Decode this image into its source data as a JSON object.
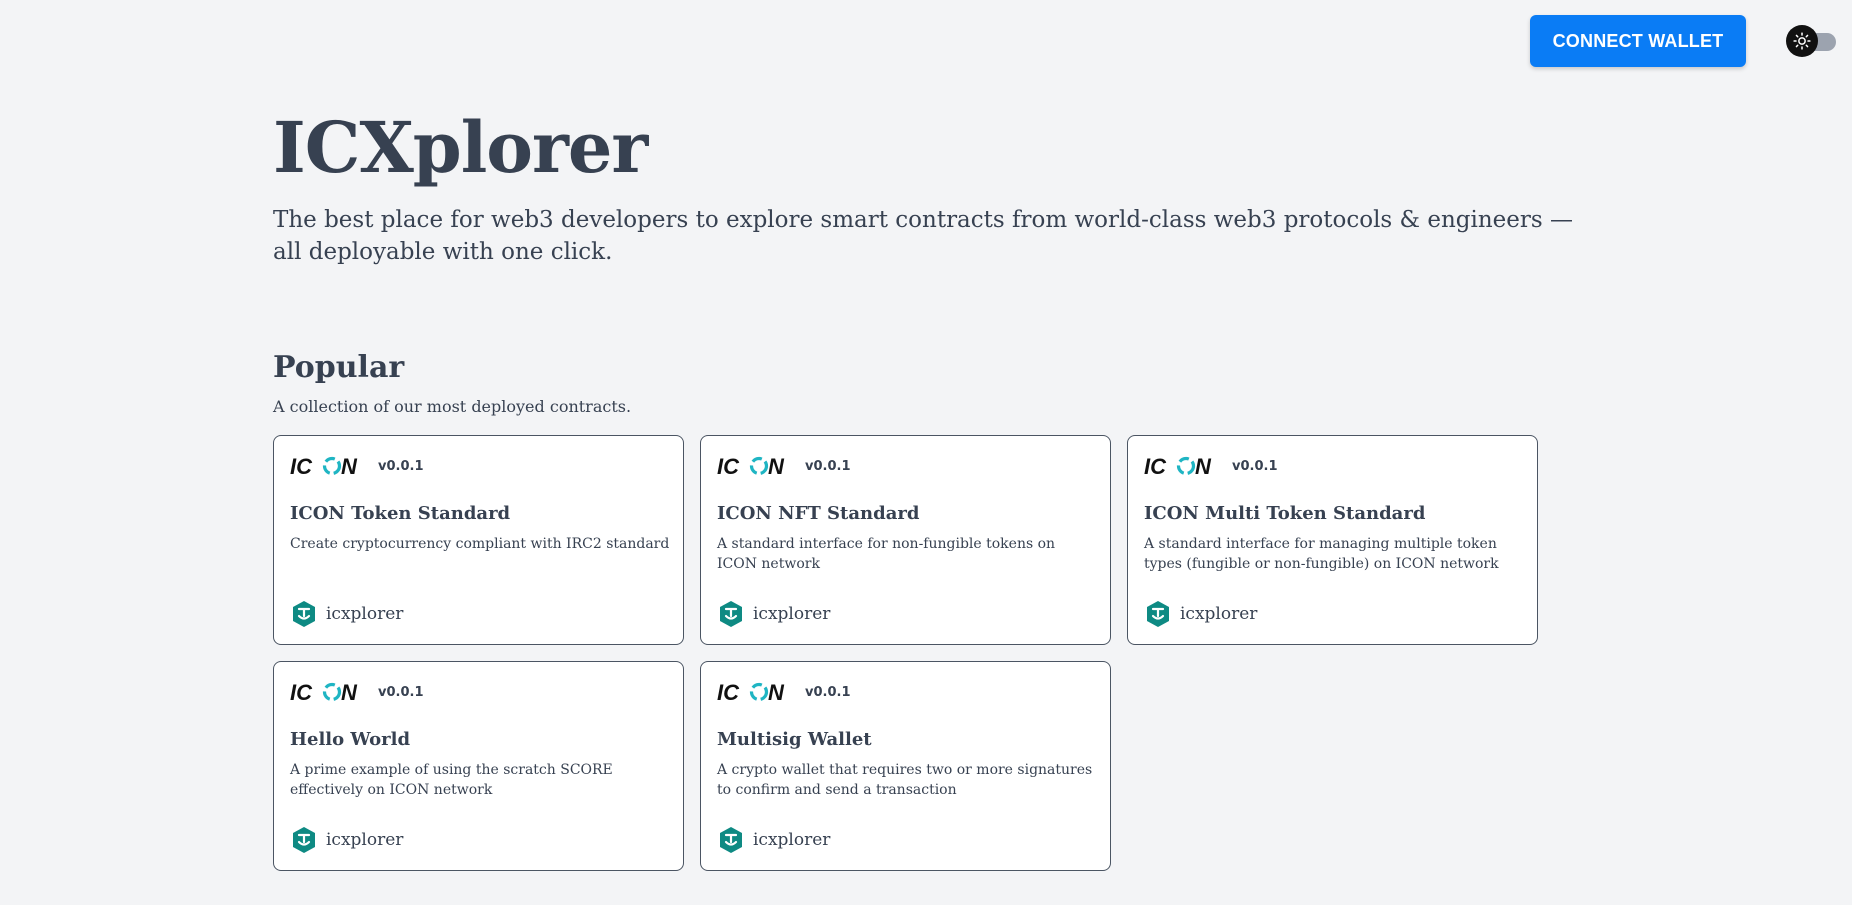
{
  "header": {
    "connect_label": "CONNECT WALLET",
    "theme_toggle_icon": "sun-icon"
  },
  "hero": {
    "title": "ICXplorer",
    "tagline": "The best place for web3 developers to explore smart contracts from world-class web3 protocols & engineers — all deployable with one click."
  },
  "popular": {
    "title": "Popular",
    "subtitle": "A collection of our most deployed contracts.",
    "cards": [
      {
        "logo_icon": "icon-network-logo",
        "version": "v0.0.1",
        "title": "ICON Token Standard",
        "description": "Create cryptocurrency compliant with IRC2 standard",
        "author": "icxplorer",
        "author_icon": "icxplorer-avatar-icon"
      },
      {
        "logo_icon": "icon-network-logo",
        "version": "v0.0.1",
        "title": "ICON NFT Standard",
        "description": "A standard interface for non-fungible tokens on ICON network",
        "author": "icxplorer",
        "author_icon": "icxplorer-avatar-icon"
      },
      {
        "logo_icon": "icon-network-logo",
        "version": "v0.0.1",
        "title": "ICON Multi Token Standard",
        "description": "A standard interface for managing multiple token types (fungible or non-fungible) on ICON network",
        "author": "icxplorer",
        "author_icon": "icxplorer-avatar-icon"
      },
      {
        "logo_icon": "icon-network-logo",
        "version": "v0.0.1",
        "title": "Hello World",
        "description": "A prime example of using the scratch SCORE effectively on ICON network",
        "author": "icxplorer",
        "author_icon": "icxplorer-avatar-icon"
      },
      {
        "logo_icon": "icon-network-logo",
        "version": "v0.0.1",
        "title": "Multisig Wallet",
        "description": "A crypto wallet that requires two or more signatures to confirm and send a transaction",
        "author": "icxplorer",
        "author_icon": "icxplorer-avatar-icon"
      }
    ]
  },
  "colors": {
    "background": "#f3f4f6",
    "primary_button": "#0a7cf5",
    "icon_teal": "#1fb5c3",
    "author_teal": "#0e8a83",
    "text": "#374151"
  }
}
